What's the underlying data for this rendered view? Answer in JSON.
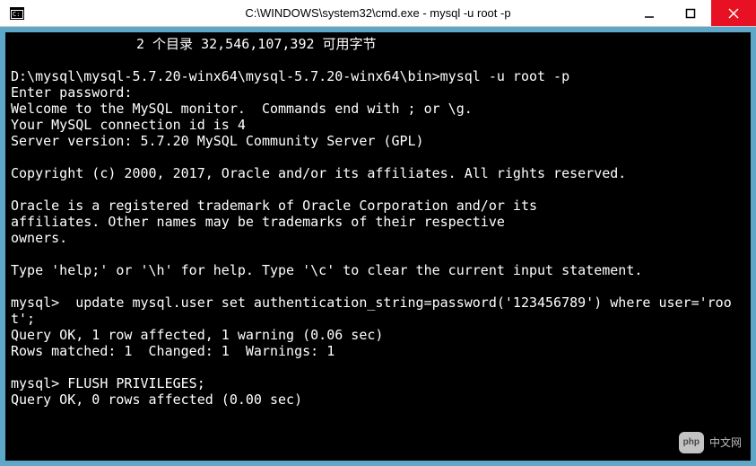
{
  "window": {
    "title": "C:\\WINDOWS\\system32\\cmd.exe - mysql  -u root -p"
  },
  "terminal": {
    "dir_line": "2 个目录 32,546,107,392 可用字节",
    "block1": "D:\\mysql\\mysql-5.7.20-winx64\\mysql-5.7.20-winx64\\bin>mysql -u root -p\nEnter password:\nWelcome to the MySQL monitor.  Commands end with ; or \\g.\nYour MySQL connection id is 4\nServer version: 5.7.20 MySQL Community Server (GPL)",
    "copyright": "Copyright (c) 2000, 2017, Oracle and/or its affiliates. All rights reserved.",
    "trademark": "Oracle is a registered trademark of Oracle Corporation and/or its\naffiliates. Other names may be trademarks of their respective\nowners.",
    "help": "Type 'help;' or '\\h' for help. Type '\\c' to clear the current input statement.",
    "query1": "mysql>  update mysql.user set authentication_string=password('123456789') where user='root';\nQuery OK, 1 row affected, 1 warning (0.06 sec)\nRows matched: 1  Changed: 1  Warnings: 1",
    "query2": "mysql> FLUSH PRIVILEGES;\nQuery OK, 0 rows affected (0.00 sec)"
  },
  "watermark": {
    "badge": "php",
    "text": "中文网"
  }
}
